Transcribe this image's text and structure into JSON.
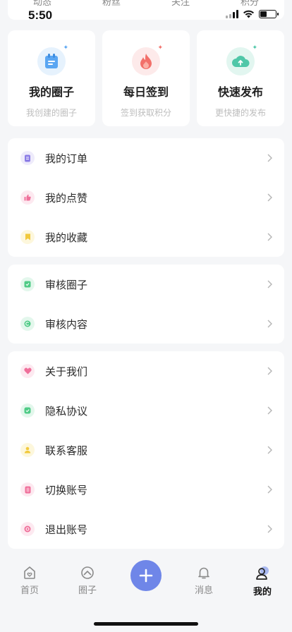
{
  "status": {
    "time": "5:50"
  },
  "top_peek": {
    "labels": [
      "动态",
      "粉丝",
      "关注",
      "积分"
    ]
  },
  "quick_actions": [
    {
      "title": "我的圈子",
      "subtitle": "我创建的圈子",
      "icon": "circle-card-icon"
    },
    {
      "title": "每日签到",
      "subtitle": "签到获取积分",
      "icon": "flame-icon"
    },
    {
      "title": "快速发布",
      "subtitle": "更快捷的发布",
      "icon": "cloud-upload-icon"
    }
  ],
  "groups": [
    {
      "items": [
        {
          "label": "我的订单",
          "icon": "order-icon",
          "color": "#8c7de6",
          "bg": "#eeebfb"
        },
        {
          "label": "我的点赞",
          "icon": "thumb-up-icon",
          "color": "#ef6f9a",
          "bg": "#fde9f0"
        },
        {
          "label": "我的收藏",
          "icon": "bookmark-icon",
          "color": "#f1c93c",
          "bg": "#fdf7dc"
        }
      ]
    },
    {
      "items": [
        {
          "label": "审核圈子",
          "icon": "review-circle-icon",
          "color": "#4fcb86",
          "bg": "#e3f7ec"
        },
        {
          "label": "审核内容",
          "icon": "review-content-icon",
          "color": "#4fcb86",
          "bg": "#e3f7ec"
        }
      ]
    },
    {
      "items": [
        {
          "label": "关于我们",
          "icon": "heart-icon",
          "color": "#ef6f9a",
          "bg": "#fde9f0"
        },
        {
          "label": "隐私协议",
          "icon": "shield-check-icon",
          "color": "#4fcb86",
          "bg": "#e3f7ec"
        },
        {
          "label": "联系客服",
          "icon": "user-icon",
          "color": "#f1c93c",
          "bg": "#fdf7dc"
        },
        {
          "label": "切换账号",
          "icon": "switch-icon",
          "color": "#ef6f9a",
          "bg": "#fde9f0"
        },
        {
          "label": "退出账号",
          "icon": "power-icon",
          "color": "#ef6f9a",
          "bg": "#fde9f0"
        }
      ]
    }
  ],
  "tabs": [
    {
      "label": "首页",
      "icon": "home-icon"
    },
    {
      "label": "圈子",
      "icon": "circle-icon"
    },
    {
      "label": "消息",
      "icon": "bell-icon"
    },
    {
      "label": "我的",
      "icon": "profile-icon",
      "active": true
    }
  ],
  "colors": {
    "accent": "#6f86e8",
    "background": "#f5f6f8"
  }
}
